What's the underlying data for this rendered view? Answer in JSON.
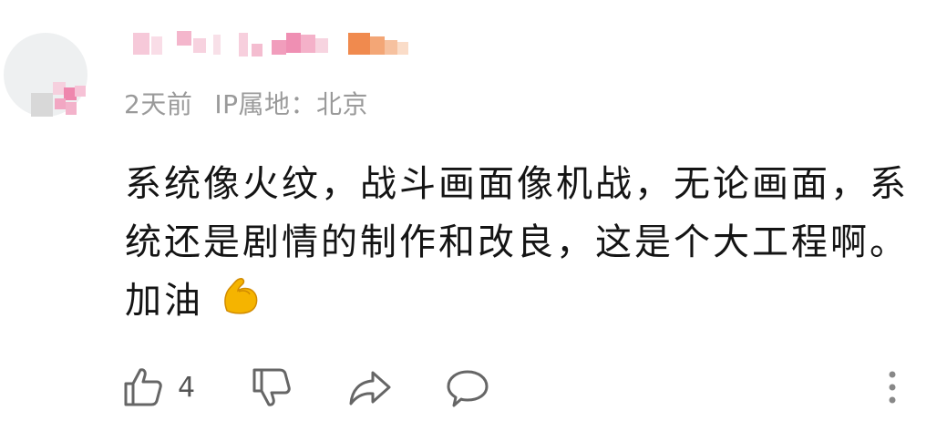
{
  "comment": {
    "time": "2天前",
    "location": "IP属地：北京",
    "body": "系统像火纹，战斗画面像机战，无论画面，系统还是剧情的制作和改良，这是个大工程啊。加油",
    "emoji": "flexed-biceps"
  },
  "actions": {
    "like_count": "4",
    "icons": [
      "thumbs-up-icon",
      "thumbs-down-icon",
      "share-icon",
      "reply-icon",
      "more-options-icon"
    ]
  },
  "colors": {
    "text": "#141414",
    "meta": "#9a9a9a",
    "icon": "#666666",
    "pink": "#f08cb2",
    "orange": "#f0945a"
  }
}
